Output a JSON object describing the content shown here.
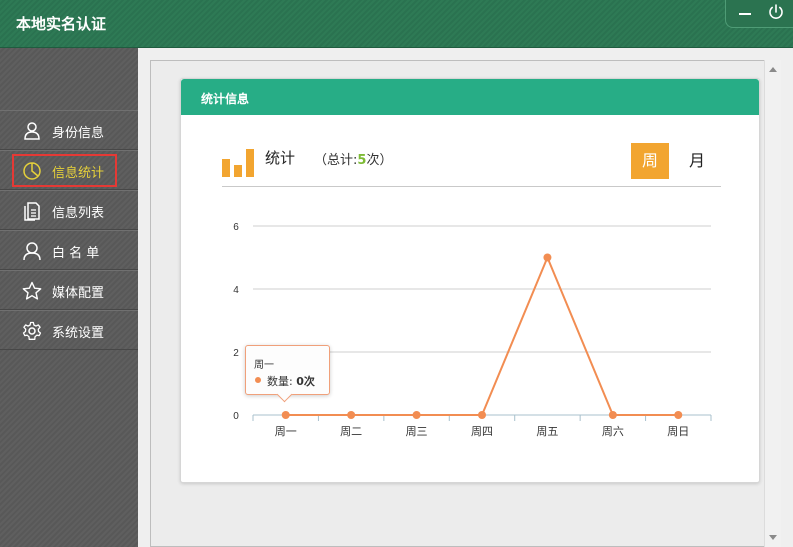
{
  "app": {
    "title": "本地实名认证"
  },
  "sidebar": {
    "items": [
      {
        "label": "身份信息",
        "icon": "user-icon"
      },
      {
        "label": "信息统计",
        "icon": "pie-chart-icon",
        "active": true
      },
      {
        "label": "信息列表",
        "icon": "document-list-icon"
      },
      {
        "label": "白 名 单",
        "icon": "user-outline-icon"
      },
      {
        "label": "媒体配置",
        "icon": "star-icon"
      },
      {
        "label": "系统设置",
        "icon": "gear-icon"
      }
    ]
  },
  "panel": {
    "header": "统计信息",
    "stats_title": "统计",
    "total_prefix": "（总计:",
    "total_value": "5",
    "total_suffix": "次）",
    "period_week": "周",
    "period_month": "月"
  },
  "colors": {
    "accent_green": "#27ad86",
    "header_green": "#2e7a55",
    "line_orange": "#f28d52",
    "button_orange": "#f2a530",
    "active_text": "#e6d13a",
    "highlight_red": "#e53935"
  },
  "tooltip": {
    "title": "周一",
    "label": "数量:",
    "value": "0次"
  },
  "chart_data": {
    "type": "line",
    "categories": [
      "周一",
      "周二",
      "周三",
      "周四",
      "周五",
      "周六",
      "周日"
    ],
    "series": [
      {
        "name": "数量",
        "values": [
          0,
          0,
          0,
          0,
          5,
          0,
          0
        ]
      }
    ],
    "yticks": [
      0,
      2,
      4,
      6
    ],
    "ylim": [
      0,
      6
    ],
    "grid": true
  }
}
